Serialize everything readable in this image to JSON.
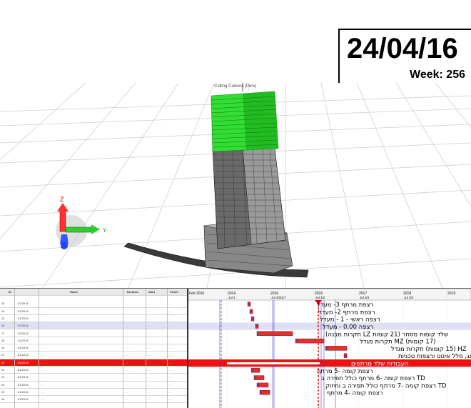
{
  "header": {
    "date": "24/04/16",
    "week": "Week: 256"
  },
  "viewport": {
    "camera_label": "Culling Camera (Pers)",
    "axis_labels": {
      "x": "X",
      "y": "Y",
      "z": "Z"
    },
    "colors": {
      "completed_floors": "#22dd22",
      "building_frame": "#555555",
      "axis_x": "#ff2222",
      "axis_y": "#22cc22",
      "axis_z": "#2244ff"
    }
  },
  "gantt": {
    "timeline_ticks": [
      "Feb 2016",
      "2014",
      "2016",
      "2016",
      "2017",
      "2018",
      "2019"
    ],
    "timeline_subticks": [
      "Jul 1",
      "Jul 2/2017",
      "Jul 3/2",
      "Jul 3/4",
      "Jul 3/4"
    ],
    "table_header": [
      "ID",
      "Name",
      "Duration",
      "Start",
      "Finish"
    ],
    "rows": [
      {
        "id": "13",
        "date": "1/1/2014",
        "name": "…",
        "dur": "…",
        "start": "…",
        "finish": "…",
        "style": "normal"
      },
      {
        "id": "14",
        "date": "1/1/2014",
        "name": "…",
        "dur": "…",
        "start": "…",
        "finish": "…",
        "style": "normal"
      },
      {
        "id": "15",
        "date": "1/1/2014",
        "name": "…",
        "dur": "…",
        "start": "…",
        "finish": "…",
        "style": "normal"
      },
      {
        "id": "16",
        "date": "1/1/2014",
        "name": "…",
        "dur": "…",
        "start": "…",
        "finish": "…",
        "style": "highlight"
      },
      {
        "id": "17",
        "date": "1/1/2014",
        "name": "…",
        "dur": "…",
        "start": "…",
        "finish": "…",
        "style": "normal"
      },
      {
        "id": "18",
        "date": "1/1/2014",
        "name": "…",
        "dur": "…",
        "start": "…",
        "finish": "…",
        "style": "normal"
      },
      {
        "id": "19",
        "date": "1/1/2014",
        "name": "…",
        "dur": "…",
        "start": "…",
        "finish": "…",
        "style": "normal"
      },
      {
        "id": "20",
        "date": "1/1/2014",
        "name": "…",
        "dur": "…",
        "start": "…",
        "finish": "…",
        "style": "normal"
      },
      {
        "id": "21",
        "date": "1/1/2014",
        "name": "…",
        "dur": "…",
        "start": "…",
        "finish": "…",
        "style": "red"
      },
      {
        "id": "22",
        "date": "1/1/2014",
        "name": "…",
        "dur": "…",
        "start": "…",
        "finish": "…",
        "style": "normal"
      },
      {
        "id": "23",
        "date": "1/1/2014",
        "name": "…",
        "dur": "…",
        "start": "…",
        "finish": "…",
        "style": "normal"
      },
      {
        "id": "24",
        "date": "1/1/2014",
        "name": "…",
        "dur": "…",
        "start": "…",
        "finish": "…",
        "style": "normal"
      },
      {
        "id": "25",
        "date": "1/1/2014",
        "name": "…",
        "dur": "…",
        "start": "…",
        "finish": "…",
        "style": "normal"
      },
      {
        "id": "26",
        "date": "1/1/2014",
        "name": "…",
        "dur": "…",
        "start": "…",
        "finish": "…",
        "style": "normal"
      }
    ],
    "task_labels": [
      "רצפת מרתף 3- מעדל",
      "רצפת מרתף 2- מעדל",
      "רצפה ראשי - 1 - מעדל",
      "רצפה 0.00 - מעדל",
      "שלד קומות מסחר (21 קומות LZ תקרות מבנה)",
      "(17 קומות) MZ תקרות מגדל",
      "HZ (15 קומות) תקרות מגדל",
      "מבנים על הגג, סלל אינוט ורצפות טכניות",
      "העבודות שלד מרתפים",
      "רצפת קומה -5 מרתף",
      "TD רצפת קומה -6 מרתף כולל תפירה ב",
      "TD רצפת קומה -7 מרתף כולל תפירה ב וחיזוק",
      "רצפת קומה -4 מרתף"
    ],
    "colors": {
      "bar": "#e03030",
      "progress": "#3344cc",
      "critical_row": "#ee1111",
      "today_line": "#dd0000"
    }
  }
}
